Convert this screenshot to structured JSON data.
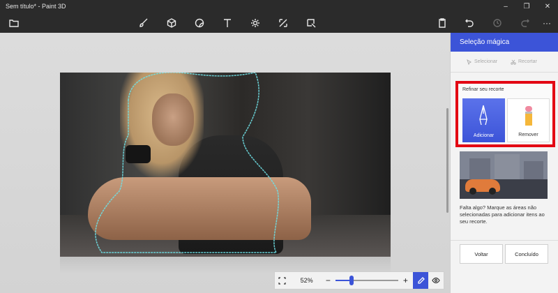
{
  "window": {
    "title": "Sem título* - Paint 3D",
    "controls": {
      "minimize": "–",
      "maximize": "❐",
      "close": "✕"
    }
  },
  "toolbar": {
    "tools": [
      "open-folder-icon",
      "brush-icon",
      "cube-icon",
      "sticker-icon",
      "text-icon",
      "effects-icon",
      "canvas-icon",
      "magic-select-icon"
    ],
    "right": [
      "paste-icon",
      "undo-icon",
      "history-icon",
      "redo-icon",
      "more-icon"
    ],
    "more_label": "···"
  },
  "zoom": {
    "percent": "52%",
    "minus": "−",
    "plus": "+",
    "level": 0.24
  },
  "panel": {
    "title": "Seleção mágica",
    "select_label": "Selecionar",
    "cut_label": "Recortar",
    "refine_label": "Refinar seu recorte",
    "add_label": "Adicionar",
    "remove_label": "Remover",
    "help_text": "Falta algo? Marque as áreas não selecionadas para adicionar itens ao seu recorte.",
    "back_label": "Voltar",
    "done_label": "Concluído"
  },
  "colors": {
    "accent": "#3c54d8",
    "highlight": "#e30613",
    "chrome": "#2b2b2b"
  }
}
